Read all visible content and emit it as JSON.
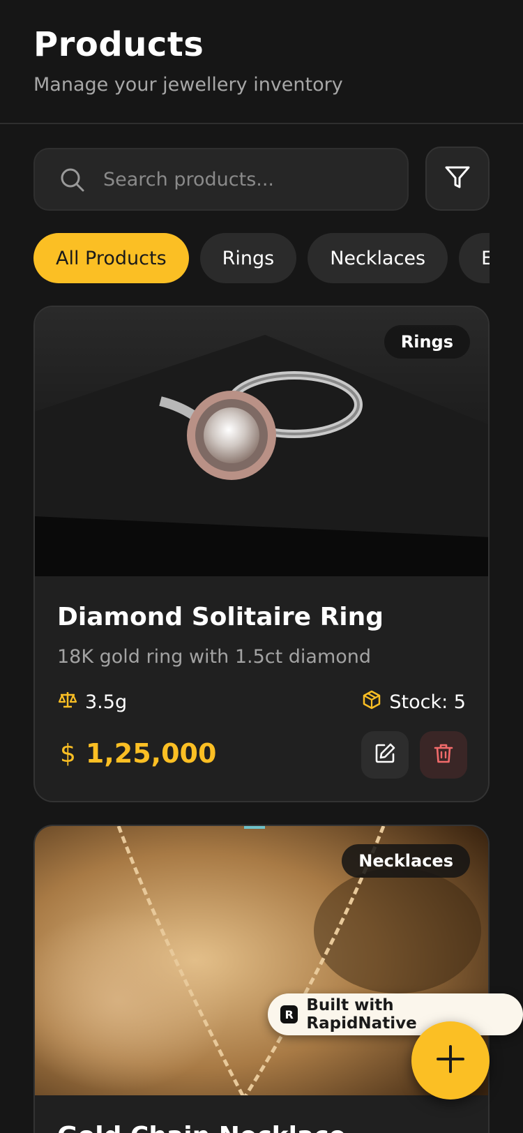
{
  "header": {
    "title": "Products",
    "subtitle": "Manage your jewellery inventory"
  },
  "search": {
    "placeholder": "Search products..."
  },
  "filters": {
    "chips": [
      "All Products",
      "Rings",
      "Necklaces",
      "Earrings"
    ],
    "active": "All Products"
  },
  "products": [
    {
      "category": "Rings",
      "name": "Diamond Solitaire Ring",
      "description": "18K gold ring with 1.5ct diamond",
      "weight": "3.5g",
      "stock": "Stock: 5",
      "currency_symbol": "$",
      "price": "1,25,000"
    },
    {
      "category": "Necklaces",
      "name": "Gold Chain Necklace"
    }
  ],
  "badge": {
    "label": "Built with RapidNative",
    "logo_letter": "R"
  },
  "colors": {
    "accent": "#fbbf24",
    "background": "#161616",
    "card": "#202020",
    "danger": "#f26b6b"
  },
  "icons": [
    "search-icon",
    "filter-icon",
    "scale-icon",
    "package-icon",
    "edit-icon",
    "trash-icon",
    "plus-icon"
  ]
}
